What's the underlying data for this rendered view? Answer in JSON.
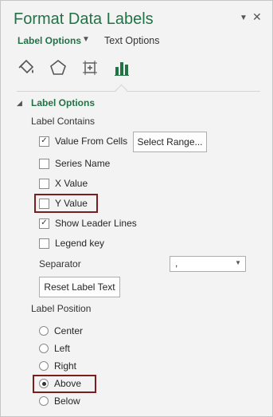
{
  "pane": {
    "title": "Format Data Labels",
    "dropdown_glyph": "▼",
    "close_glyph": "✕"
  },
  "tabs": {
    "label_options": "Label Options",
    "text_options": "Text Options",
    "arrow": "▼"
  },
  "icons": [
    "fill-line-icon",
    "effects-icon",
    "size-properties-icon",
    "label-options-icon"
  ],
  "section": {
    "title": "Label Options",
    "collapse_glyph": "◢"
  },
  "label_contains": {
    "title": "Label Contains",
    "items": [
      {
        "label": "Value From Cells",
        "checked": true
      },
      {
        "label": "Series Name",
        "checked": false
      },
      {
        "label": "X Value",
        "checked": false
      },
      {
        "label": "Y Value",
        "checked": false
      },
      {
        "label": "Show Leader Lines",
        "checked": true
      },
      {
        "label": "Legend key",
        "checked": false
      }
    ],
    "check_glyph": "✓",
    "select_range_label": "Select Range..."
  },
  "separator": {
    "label": "Separator",
    "value": ",",
    "arrow": "▼"
  },
  "reset_button": "Reset Label Text",
  "label_position": {
    "title": "Label Position",
    "options": [
      "Center",
      "Left",
      "Right",
      "Above",
      "Below"
    ],
    "selected": "Above"
  },
  "colors": {
    "accent": "#217346",
    "highlight_border": "#7b1e1e"
  }
}
